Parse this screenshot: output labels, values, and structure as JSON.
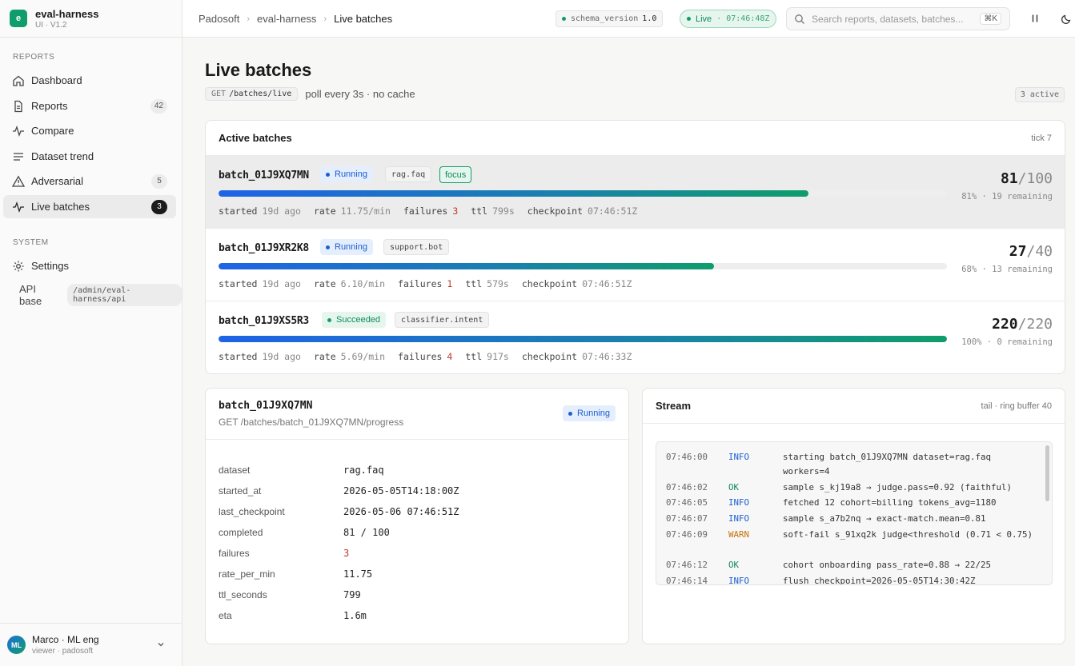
{
  "app": {
    "name": "eval-harness",
    "version": "UI · V1.2",
    "logo_letter": "e"
  },
  "sidebar": {
    "sections": {
      "reports": "REPORTS",
      "system": "SYSTEM"
    },
    "items": [
      {
        "label": "Dashboard",
        "icon": "home-icon"
      },
      {
        "label": "Reports",
        "icon": "file-icon",
        "badge": "42"
      },
      {
        "label": "Compare",
        "icon": "pulse-icon"
      },
      {
        "label": "Dataset trend",
        "icon": "list-icon"
      },
      {
        "label": "Adversarial",
        "icon": "warning-icon",
        "badge": "5"
      },
      {
        "label": "Live batches",
        "icon": "pulse-icon",
        "badge": "3",
        "active": true
      }
    ],
    "settings": "Settings",
    "api_label": "API base",
    "api_value": "/admin/eval-harness/api",
    "user": {
      "initials": "ML",
      "name": "Marco · ML eng",
      "role": "viewer · padosoft"
    }
  },
  "topbar": {
    "crumbs": [
      "Padosoft",
      "eval-harness",
      "Live batches"
    ],
    "schema_label": "schema_version",
    "schema_value": "1.0",
    "live_label": "Live",
    "live_time": "· 07:46:48Z",
    "search_placeholder": "Search reports, datasets, batches...",
    "search_kbd": "⌘K"
  },
  "page": {
    "title": "Live batches",
    "method": "GET",
    "endpoint": "/batches/live",
    "poll_text": "poll every 3s · no cache",
    "active_count": "3 active"
  },
  "active_batches": {
    "title": "Active batches",
    "tick": "tick 7",
    "rows": [
      {
        "id": "batch_01J9XQ7MN",
        "status": "Running",
        "tag": "rag.faq",
        "focus": "focus",
        "done": "81",
        "total": "/100",
        "progress": 0.81,
        "pct": "81% · 19 remaining",
        "started": "19d ago",
        "rate": "11.75/min",
        "failures": "3",
        "ttl": "799s",
        "checkpoint": "07:46:51Z"
      },
      {
        "id": "batch_01J9XR2K8",
        "status": "Running",
        "tag": "support.bot",
        "done": "27",
        "total": "/40",
        "progress": 0.68,
        "pct": "68% · 13 remaining",
        "started": "19d ago",
        "rate": "6.10/min",
        "failures": "1",
        "ttl": "579s",
        "checkpoint": "07:46:51Z"
      },
      {
        "id": "batch_01J9XS5R3",
        "status": "Succeeded",
        "tag": "classifier.intent",
        "done": "220",
        "total": "/220",
        "progress": 1.0,
        "pct": "100% · 0 remaining",
        "started": "19d ago",
        "rate": "5.69/min",
        "failures": "4",
        "ttl": "917s",
        "checkpoint": "07:46:33Z"
      }
    ],
    "labels": {
      "started": "started",
      "rate": "rate",
      "failures": "failures",
      "ttl": "ttl",
      "checkpoint": "checkpoint"
    }
  },
  "detail": {
    "title": "batch_01J9XQ7MN",
    "path": "GET /batches/batch_01J9XQ7MN/progress",
    "status": "Running",
    "fields": [
      {
        "k": "dataset",
        "v": "rag.faq"
      },
      {
        "k": "started_at",
        "v": "2026-05-05T14:18:00Z"
      },
      {
        "k": "last_checkpoint",
        "v": "2026-05-06 07:46:51Z"
      },
      {
        "k": "completed",
        "v": "81 / 100"
      },
      {
        "k": "failures",
        "v": "3"
      },
      {
        "k": "rate_per_min",
        "v": "11.75"
      },
      {
        "k": "ttl_seconds",
        "v": "799"
      },
      {
        "k": "eta",
        "v": "1.6m"
      }
    ]
  },
  "stream": {
    "title": "Stream",
    "meta": "tail · ring buffer 40",
    "lines": [
      {
        "ts": "07:46:00",
        "lv": "INFO",
        "msg": "starting batch_01J9XQ7MN dataset=rag.faq workers=4"
      },
      {
        "ts": "07:46:02",
        "lv": "OK",
        "msg": "sample s_kj19a8 → judge.pass=0.92 (faithful)"
      },
      {
        "ts": "07:46:05",
        "lv": "INFO",
        "msg": "fetched 12 cohort=billing tokens_avg=1180"
      },
      {
        "ts": "07:46:07",
        "lv": "INFO",
        "msg": "sample s_a7b2nq → exact-match.mean=0.81"
      },
      {
        "ts": "07:46:09",
        "lv": "WARN",
        "msg": "soft-fail s_91xq2k judge<threshold (0.71 < 0.75)"
      },
      {
        "ts": "07:46:12",
        "lv": "OK",
        "msg": "cohort onboarding pass_rate=0.88 → 22/25"
      },
      {
        "ts": "07:46:14",
        "lv": "INFO",
        "msg": "flush checkpoint=2026-05-05T14:30:42Z"
      }
    ]
  },
  "colors": {
    "accent": "#0f9d6b",
    "running": "#1d5fd1",
    "warn": "#c7700a",
    "fail": "#c0392b"
  }
}
